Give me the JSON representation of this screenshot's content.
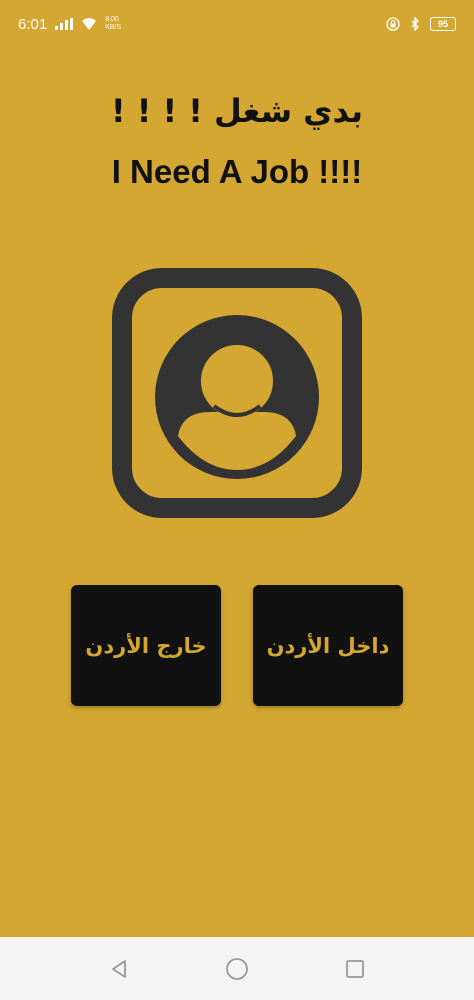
{
  "status_bar": {
    "time": "6:01",
    "net_speed_value": "8.00",
    "net_speed_unit": "KB/S",
    "battery": "95"
  },
  "header": {
    "title_arabic": "بدي شغل ! ! ! !",
    "title_english": "I Need A Job !!!!"
  },
  "buttons": {
    "outside_label": "خارج الأردن",
    "inside_label": "داخل الأردن"
  },
  "colors": {
    "background": "#d4a733",
    "button_bg": "#111111",
    "button_text": "#d4a733",
    "icon": "#333333"
  },
  "icons": [
    "signal-icon",
    "wifi-icon",
    "lock-icon",
    "bluetooth-icon",
    "battery-icon",
    "profile-icon",
    "back-icon",
    "home-icon",
    "recents-icon"
  ]
}
